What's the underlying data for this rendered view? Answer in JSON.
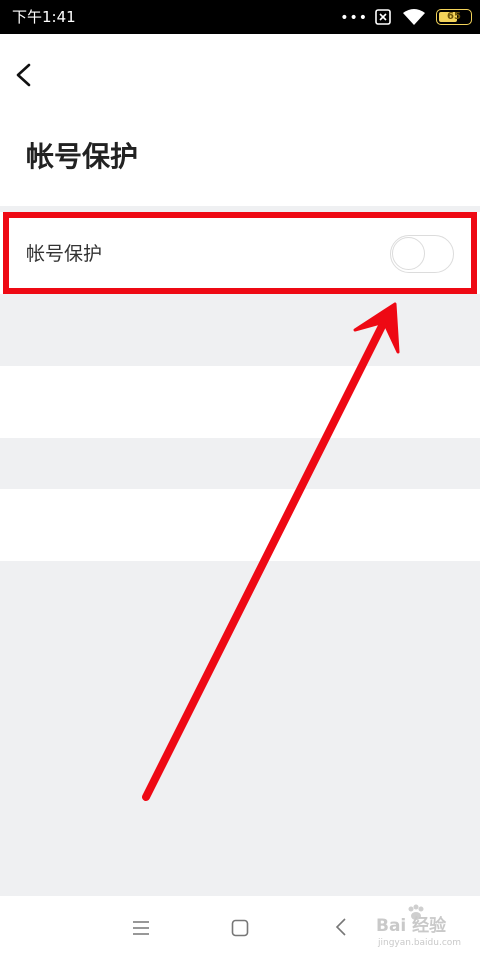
{
  "status_bar": {
    "time": "下午1:41",
    "dots": "•••",
    "battery_level": "65",
    "battery_fraction": 0.65
  },
  "header": {
    "title": "帐号保护"
  },
  "settings": {
    "items": [
      {
        "label": "帐号保护",
        "enabled": false
      }
    ]
  },
  "watermark": {
    "brand": "Bai 经验",
    "url": "jingyan.baidu.com"
  },
  "colors": {
    "highlight": "#ee0914",
    "page_background": "#eff0f2",
    "battery": "#f3d35a"
  },
  "icons": {
    "back": "back-arrow-icon",
    "nav_menu": "menu-icon",
    "nav_home": "home-icon",
    "nav_back": "back-icon"
  }
}
